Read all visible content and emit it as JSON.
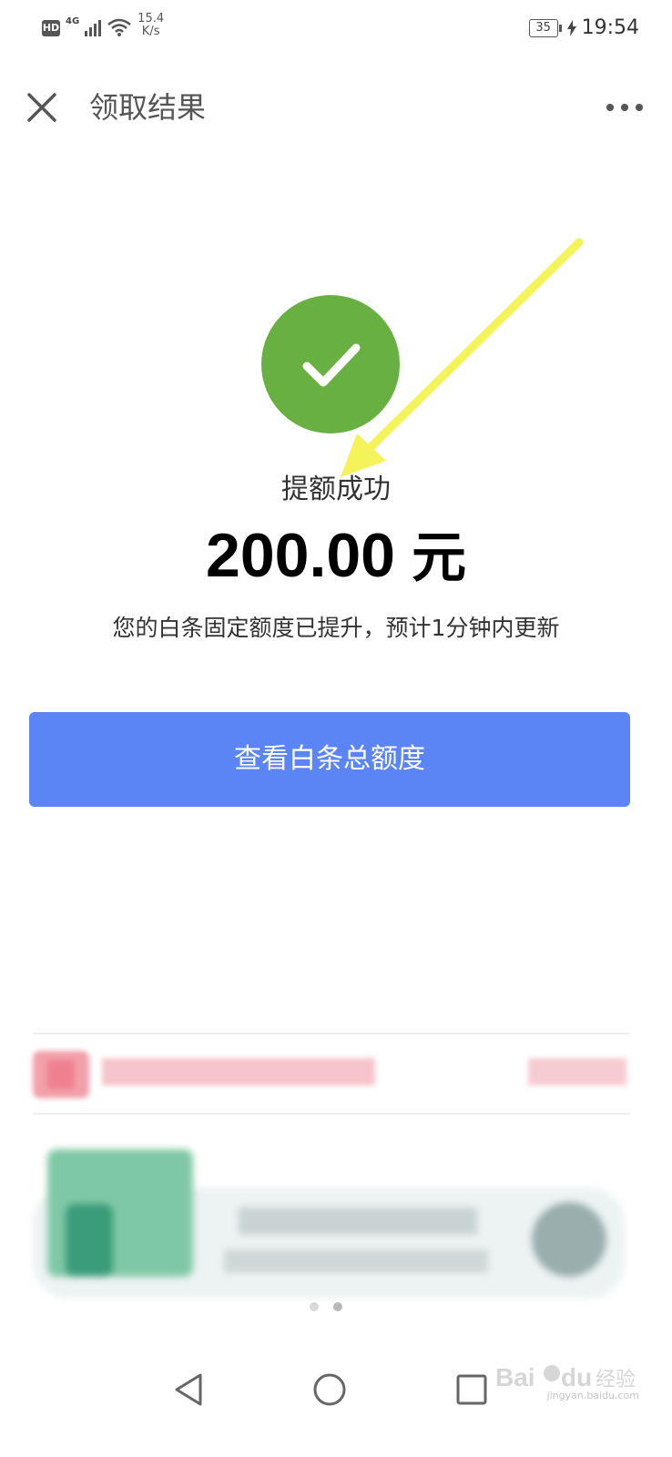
{
  "status_bar": {
    "hd": "HD",
    "network": "4G",
    "speed_value": "15.4",
    "speed_unit": "K/s",
    "battery": "35",
    "time": "19:54"
  },
  "title_bar": {
    "title": "领取结果",
    "close_icon": "close-icon",
    "more_icon": "more-icon"
  },
  "result": {
    "status_text": "提额成功",
    "amount": "200.00",
    "unit": "元",
    "description": "您的白条固定额度已提升，预计1分钟内更新",
    "icon": "checkmark-icon",
    "icon_color": "#69b042",
    "annotation_arrow_color": "#f4f35a"
  },
  "primary_button": {
    "label": "查看白条总额度",
    "color": "#5b85f5"
  },
  "promo": {
    "pager_total": 2,
    "pager_active": 2
  },
  "watermark": {
    "text": "jingyan.baidu.com"
  }
}
